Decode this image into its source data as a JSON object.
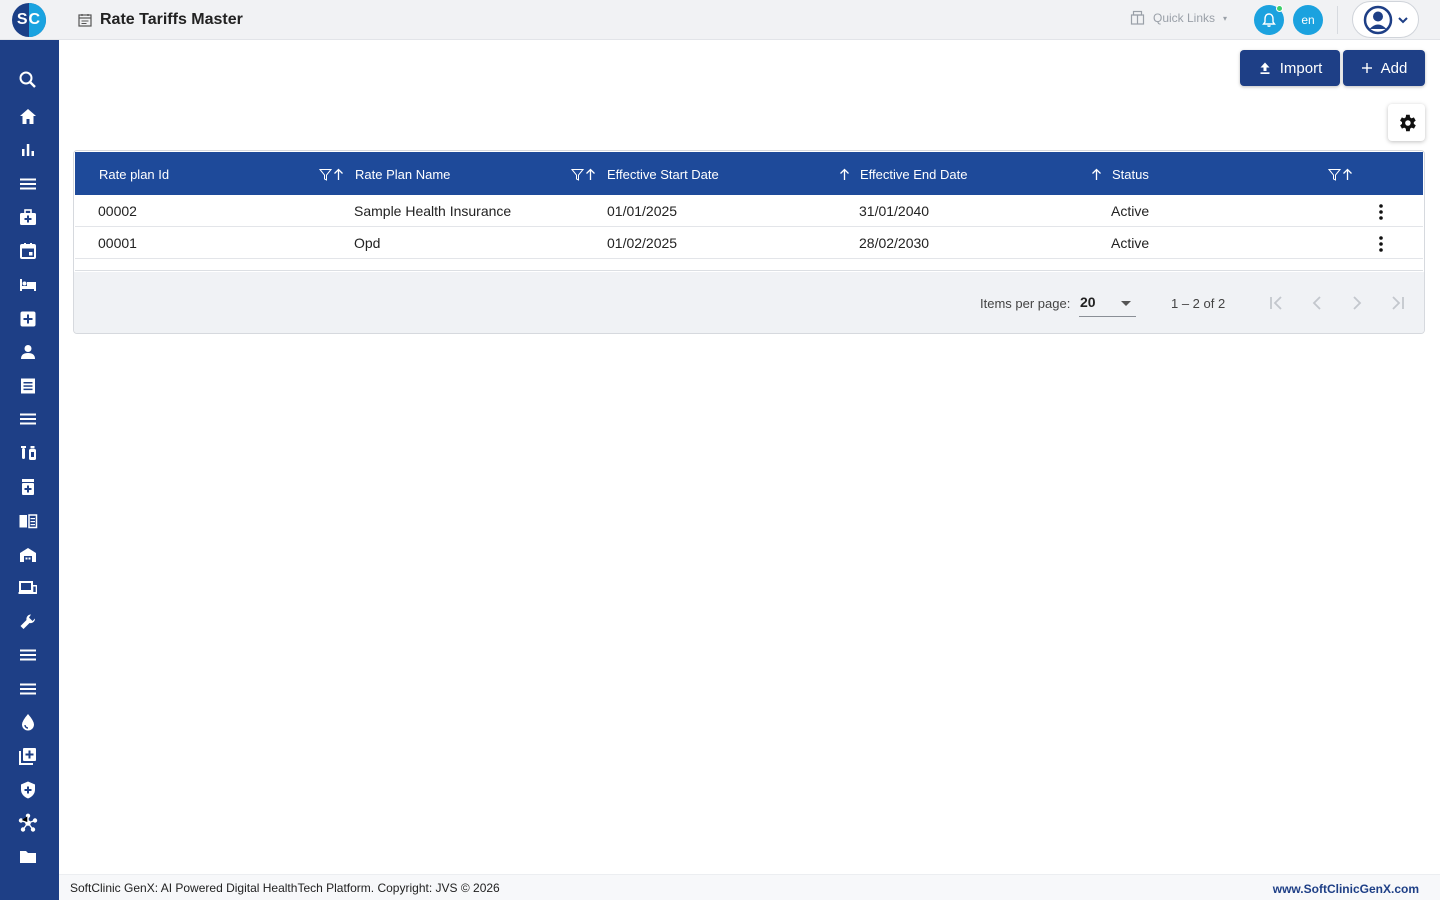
{
  "header": {
    "logo_text": "SC",
    "page_title": "Rate Tariffs Master",
    "quick_links_label": "Quick Links",
    "language_label": "en"
  },
  "actions": {
    "import_label": "Import",
    "add_label": "Add"
  },
  "sidebar": {
    "items": [
      {
        "icon": "search-icon"
      },
      {
        "icon": "home-icon"
      },
      {
        "icon": "bar-chart-icon"
      },
      {
        "icon": "menu-icon"
      },
      {
        "icon": "medical-bag-icon"
      },
      {
        "icon": "calendar-icon"
      },
      {
        "icon": "bed-icon"
      },
      {
        "icon": "medical-cross-icon"
      },
      {
        "icon": "person-icon"
      },
      {
        "icon": "receipt-icon"
      },
      {
        "icon": "menu-icon"
      },
      {
        "icon": "lab-icon"
      },
      {
        "icon": "medicine-box-icon"
      },
      {
        "icon": "book-icon"
      },
      {
        "icon": "store-icon"
      },
      {
        "icon": "devices-icon"
      },
      {
        "icon": "wrench-icon"
      },
      {
        "icon": "menu-icon"
      },
      {
        "icon": "menu-icon"
      },
      {
        "icon": "drop-icon"
      },
      {
        "icon": "add-box-icon"
      },
      {
        "icon": "shield-icon"
      },
      {
        "icon": "hub-icon"
      },
      {
        "icon": "folder-icon"
      }
    ]
  },
  "table": {
    "columns": [
      "Rate plan Id",
      "Rate Plan Name",
      "Effective Start Date",
      "Effective End Date",
      "Status"
    ],
    "rows": [
      [
        "00002",
        "Sample Health Insurance",
        "01/01/2025",
        "31/01/2040",
        "Active"
      ],
      [
        "00001",
        "Opd",
        "01/02/2025",
        "28/02/2030",
        "Active"
      ]
    ]
  },
  "paginator": {
    "items_per_page_label": "Items per page:",
    "items_per_page_value": "20",
    "range_label": "1 – 2 of 2"
  },
  "footer": {
    "copyright": "SoftClinic GenX: AI Powered Digital HealthTech Platform. Copyright: JVS © 2026",
    "website": "www.SoftClinicGenX.com"
  },
  "colors": {
    "primary": "#1e3f86",
    "header_row": "#1e4a9a",
    "accent": "#1ba2df"
  }
}
